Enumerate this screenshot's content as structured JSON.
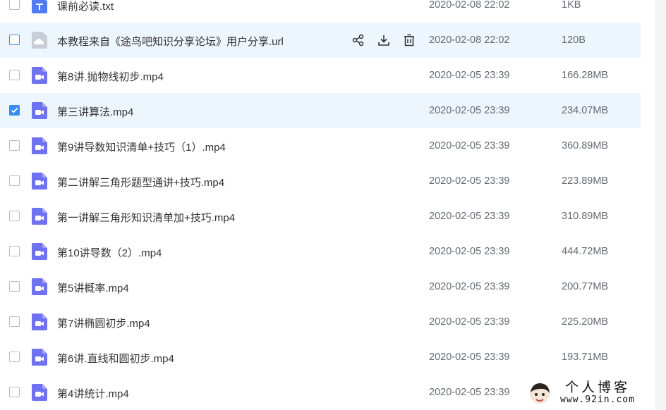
{
  "files": [
    {
      "name": "课前必读.txt",
      "date": "2020-02-08 22:02",
      "size": "1KB",
      "type": "txt",
      "checked": false,
      "hover": false,
      "selected": false
    },
    {
      "name": "本教程来自《途鸟吧知识分享论坛》用户分享.url",
      "date": "2020-02-08 22:02",
      "size": "120B",
      "type": "url",
      "checked": false,
      "hover": true,
      "selected": false
    },
    {
      "name": "第8讲.抛物线初步.mp4",
      "date": "2020-02-05 23:39",
      "size": "166.28MB",
      "type": "video",
      "checked": false,
      "hover": false,
      "selected": false
    },
    {
      "name": "第三讲算法.mp4",
      "date": "2020-02-05 23:39",
      "size": "234.07MB",
      "type": "video",
      "checked": true,
      "hover": false,
      "selected": true
    },
    {
      "name": "第9讲导数知识清单+技巧（1）.mp4",
      "date": "2020-02-05 23:39",
      "size": "360.89MB",
      "type": "video",
      "checked": false,
      "hover": false,
      "selected": false
    },
    {
      "name": "第二讲解三角形题型通讲+技巧.mp4",
      "date": "2020-02-05 23:39",
      "size": "223.89MB",
      "type": "video",
      "checked": false,
      "hover": false,
      "selected": false
    },
    {
      "name": "第一讲解三角形知识清单加+技巧.mp4",
      "date": "2020-02-05 23:39",
      "size": "310.89MB",
      "type": "video",
      "checked": false,
      "hover": false,
      "selected": false
    },
    {
      "name": "第10讲导数（2）.mp4",
      "date": "2020-02-05 23:39",
      "size": "444.72MB",
      "type": "video",
      "checked": false,
      "hover": false,
      "selected": false
    },
    {
      "name": "第5讲概率.mp4",
      "date": "2020-02-05 23:39",
      "size": "200.77MB",
      "type": "video",
      "checked": false,
      "hover": false,
      "selected": false
    },
    {
      "name": "第7讲椭圆初步.mp4",
      "date": "2020-02-05 23:39",
      "size": "225.20MB",
      "type": "video",
      "checked": false,
      "hover": false,
      "selected": false
    },
    {
      "name": "第6讲.直线和圆初步.mp4",
      "date": "2020-02-05 23:39",
      "size": "193.71MB",
      "type": "video",
      "checked": false,
      "hover": false,
      "selected": false
    },
    {
      "name": "第4讲统计.mp4",
      "date": "2020-02-05 23:39",
      "size": "",
      "type": "video",
      "checked": false,
      "hover": false,
      "selected": false
    }
  ],
  "row_actions": [
    "share-icon",
    "download-icon",
    "delete-icon"
  ],
  "colors": {
    "accent": "#3b8cf0",
    "video_icon": "#6f72f0",
    "txt_icon": "#4f7cf5",
    "url_icon": "#c8cdd6",
    "row_highlight": "#eef6fd"
  },
  "watermark": {
    "title": "个人博客",
    "url": "www.92in.com"
  }
}
